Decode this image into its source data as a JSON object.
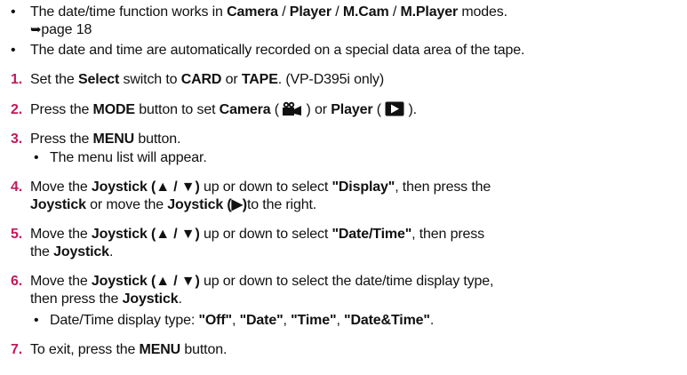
{
  "bullets": [
    {
      "parts": [
        {
          "t": "The date/time function works in ",
          "b": false
        },
        {
          "t": "Camera",
          "b": true
        },
        {
          "t": " / ",
          "b": false
        },
        {
          "t": "Player",
          "b": true
        },
        {
          "t": " / ",
          "b": false
        },
        {
          "t": "M.Cam",
          "b": true
        },
        {
          "t": " / ",
          "b": false
        },
        {
          "t": "M.Player",
          "b": true
        },
        {
          "t": " modes.",
          "b": false
        }
      ],
      "ref_arrow": "➥",
      "ref_text": "page 18"
    },
    {
      "text": "The date and time are automatically recorded on a special data area of the tape."
    }
  ],
  "steps": [
    {
      "n": "1.",
      "parts": [
        {
          "t": "Set the ",
          "b": false
        },
        {
          "t": "Select",
          "b": true
        },
        {
          "t": " switch to ",
          "b": false
        },
        {
          "t": "CARD",
          "b": true
        },
        {
          "t": " or ",
          "b": false
        },
        {
          "t": "TAPE",
          "b": true
        },
        {
          "t": ". (VP-D395i only)",
          "b": false
        }
      ]
    },
    {
      "n": "2.",
      "parts": [
        {
          "t": "Press the ",
          "b": false
        },
        {
          "t": "MODE",
          "b": true
        },
        {
          "t": " button to set ",
          "b": false
        },
        {
          "t": "Camera",
          "b": true
        },
        {
          "t": " ( ",
          "b": false
        },
        {
          "icon": "camera-icon"
        },
        {
          "t": " ) or ",
          "b": false
        },
        {
          "t": "Player",
          "b": true
        },
        {
          "t": " ( ",
          "b": false
        },
        {
          "icon": "play-icon"
        },
        {
          "t": " ).",
          "b": false
        }
      ]
    },
    {
      "n": "3.",
      "parts": [
        {
          "t": "Press the ",
          "b": false
        },
        {
          "t": "MENU",
          "b": true
        },
        {
          "t": " button.",
          "b": false
        }
      ]
    },
    {
      "sub": "The menu list will appear."
    },
    {
      "n": "4.",
      "parts": [
        {
          "t": "Move the ",
          "b": false
        },
        {
          "t": "Joystick (▲ / ▼)",
          "b": true
        },
        {
          "t": " up or down to select ",
          "b": false
        },
        {
          "t": "\"Display\"",
          "b": true
        },
        {
          "t": ", then press the",
          "b": false
        }
      ]
    },
    {
      "cont": [
        {
          "t": "Joystick",
          "b": true
        },
        {
          "t": " or move the ",
          "b": false
        },
        {
          "t": "Joystick (▶)",
          "b": true
        },
        {
          "t": "to the right.",
          "b": false
        }
      ]
    },
    {
      "n": "5.",
      "parts": [
        {
          "t": "Move the ",
          "b": false
        },
        {
          "t": "Joystick (▲ / ▼)",
          "b": true
        },
        {
          "t": " up or down to select ",
          "b": false
        },
        {
          "t": "\"Date/Time\"",
          "b": true
        },
        {
          "t": ", then press",
          "b": false
        }
      ]
    },
    {
      "cont": [
        {
          "t": "the ",
          "b": false
        },
        {
          "t": "Joystick",
          "b": true
        },
        {
          "t": ".",
          "b": false
        }
      ]
    },
    {
      "n": "6.",
      "parts": [
        {
          "t": "Move the ",
          "b": false
        },
        {
          "t": "Joystick (▲ / ▼)",
          "b": true
        },
        {
          "t": " up or down to select the date/time display type,",
          "b": false
        }
      ]
    },
    {
      "cont": [
        {
          "t": "then press the ",
          "b": false
        },
        {
          "t": "Joystick",
          "b": true
        },
        {
          "t": ".",
          "b": false
        }
      ]
    },
    {
      "sub_parts": [
        {
          "t": "Date/Time display type: ",
          "b": false
        },
        {
          "t": "\"Off\"",
          "b": true
        },
        {
          "t": ", ",
          "b": false
        },
        {
          "t": "\"Date\"",
          "b": true
        },
        {
          "t": ", ",
          "b": false
        },
        {
          "t": "\"Time\"",
          "b": true
        },
        {
          "t": ", ",
          "b": false
        },
        {
          "t": "\"Date&Time\"",
          "b": true
        },
        {
          "t": ".",
          "b": false
        }
      ]
    },
    {
      "n": "7.",
      "parts": [
        {
          "t": "To exit, press the ",
          "b": false
        },
        {
          "t": "MENU",
          "b": true
        },
        {
          "t": " button.",
          "b": false
        }
      ]
    }
  ],
  "colors": {
    "step_number": "#c2185b",
    "bullet": "#111111",
    "text": "#111111"
  }
}
